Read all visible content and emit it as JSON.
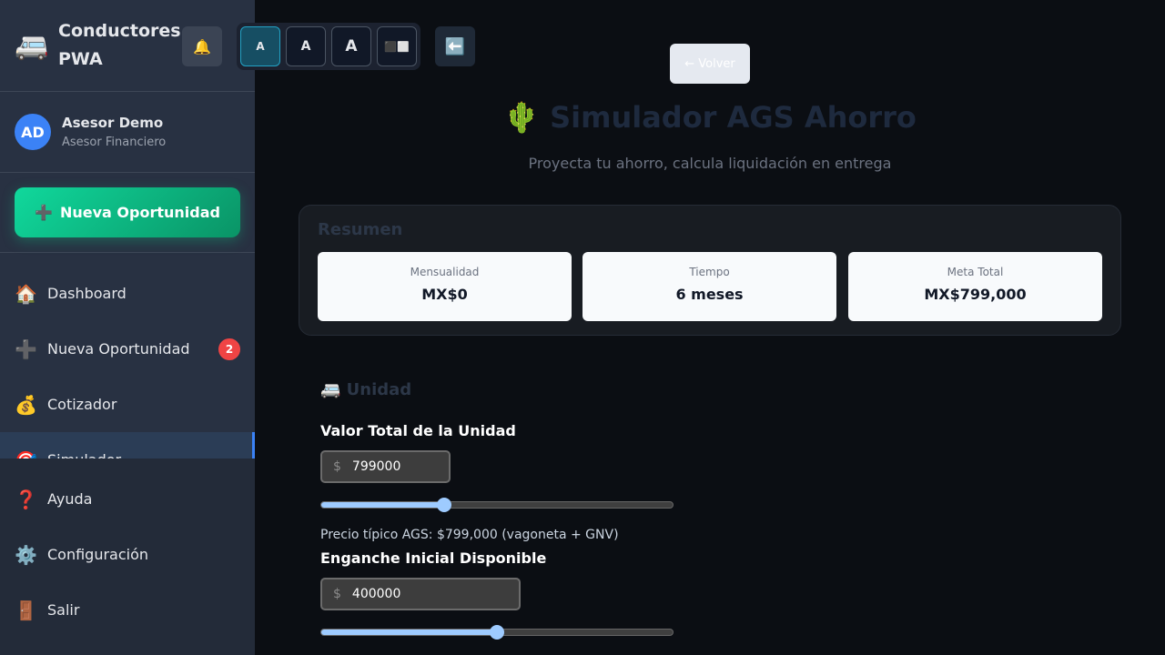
{
  "brand": {
    "icon": "🚐",
    "title": "Conductores PWA"
  },
  "user": {
    "initials": "AD",
    "name": "Asesor Demo",
    "role": "Asesor Financiero"
  },
  "new_opportunity_button": {
    "icon": "➕",
    "label": "Nueva Oportunidad"
  },
  "nav_top": [
    {
      "icon": "🏠",
      "label": "Dashboard"
    },
    {
      "icon": "➕",
      "label": "Nueva Oportunidad",
      "badge": "2"
    },
    {
      "icon": "💰",
      "label": "Cotizador"
    },
    {
      "icon": "🎯",
      "label": "Simulador"
    }
  ],
  "nav_bottom": [
    {
      "icon": "❓",
      "label": "Ayuda"
    },
    {
      "icon": "⚙️",
      "label": "Configuración"
    },
    {
      "icon": "🚪",
      "label": "Salir"
    }
  ],
  "header": {
    "bell_icon": "🔔",
    "font_sizes": [
      "A",
      "A",
      "A"
    ],
    "contrast_icon": "⬛⬜",
    "back_icon": "⬅️"
  },
  "main": {
    "back_button": "← Volver",
    "title": "🌵 Simulador AGS Ahorro",
    "subtitle": "Proyecta tu ahorro, calcula liquidación en entrega",
    "summary": {
      "title": "Resumen",
      "cards": [
        {
          "label": "Mensualidad",
          "value": "MX$0"
        },
        {
          "label": "Tiempo",
          "value": "6 meses"
        },
        {
          "label": "Meta Total",
          "value": "MX$799,000"
        }
      ]
    },
    "unit": {
      "heading": "🚐 Unidad",
      "total_value_label": "Valor Total de la Unidad",
      "currency_symbol": "$",
      "total_value": "799000",
      "total_value_slider_fraction": 0.35,
      "hint": "Precio típico AGS: $799,000 (vagoneta + GNV)",
      "down_payment_label": "Enganche Inicial Disponible",
      "down_payment": "400000",
      "down_payment_slider_fraction": 0.5
    }
  },
  "colors": {
    "accent_green": "#10b981",
    "accent_blue": "#3b82f6",
    "badge_red": "#ef4444",
    "slider": "#9ecbff"
  }
}
